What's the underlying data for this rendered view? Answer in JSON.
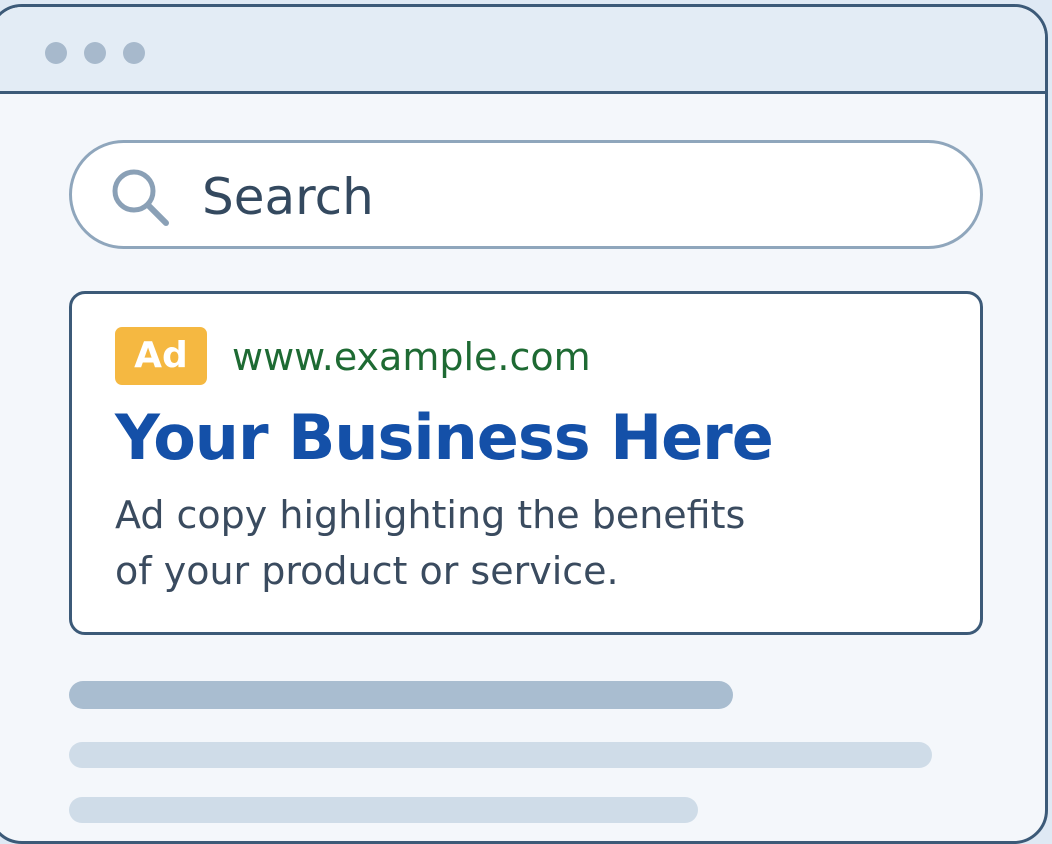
{
  "window": {
    "controls": [
      "dot-1",
      "dot-2",
      "dot-3"
    ]
  },
  "search": {
    "placeholder": "Search",
    "icon": "search-icon"
  },
  "ad": {
    "badge": "Ad",
    "url": "www.example.com",
    "headline": "Your Business Here",
    "copy_line1": "Ad copy highlighting the benefits",
    "copy_line2": "of your product or service."
  },
  "colors": {
    "accent": "#1450a8",
    "url_green": "#1e6a33",
    "badge_yellow": "#f5b841",
    "border": "#3c5a78",
    "placeholder_dark": "#a9bdd0",
    "placeholder_light": "#cfdce8"
  }
}
